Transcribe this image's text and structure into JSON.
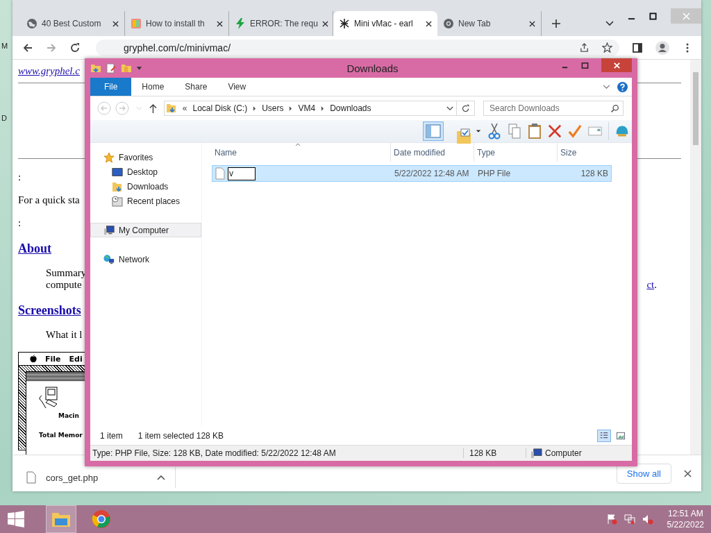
{
  "desktop": {
    "icon_labels": [
      "M",
      "D"
    ]
  },
  "browser": {
    "tabs": [
      {
        "title": "40 Best Custom",
        "selected": false
      },
      {
        "title": "How to install th",
        "selected": false
      },
      {
        "title": "ERROR: The requ",
        "selected": false
      },
      {
        "title": "Mini vMac - earl",
        "selected": true
      },
      {
        "title": "New Tab",
        "selected": false
      }
    ],
    "url": "gryphel.com/c/minivmac/",
    "page": {
      "site_link": "www.gryphel.c",
      "colon_1": ":",
      "quick_start": "For a quick sta",
      "colon_2": ":",
      "about": "About",
      "summary": "Summary",
      "computer": "compute",
      "link_end": "ct",
      "period": ".",
      "screenshots": "Screenshots",
      "what_it": "What it l",
      "mac_screenshot": {
        "menu": [
          "File",
          "Edi"
        ],
        "caption": "Macin",
        "memory": "Total Memor"
      }
    },
    "download": {
      "file": "cors_get.php",
      "show_all": "Show all"
    }
  },
  "explorer": {
    "title": "Downloads",
    "ribbon_tabs": [
      {
        "label": "File",
        "selected": true
      },
      {
        "label": "Home",
        "selected": false
      },
      {
        "label": "Share",
        "selected": false
      },
      {
        "label": "View",
        "selected": false
      }
    ],
    "crumb_overflow": "«",
    "crumbs": [
      "Local Disk (C:)",
      "Users",
      "VM4",
      "Downloads"
    ],
    "search": {
      "placeholder": "Search Downloads"
    },
    "nav": [
      {
        "label": "Favorites",
        "selected": false,
        "children": [
          {
            "label": "Desktop",
            "selected": false
          },
          {
            "label": "Downloads",
            "selected": false
          },
          {
            "label": "Recent places",
            "selected": false
          }
        ]
      },
      {
        "label": "My Computer",
        "selected": true
      },
      {
        "label": "Network",
        "selected": false
      }
    ],
    "columns": [
      "Name",
      "Date modified",
      "Type",
      "Size"
    ],
    "rows": [
      {
        "name_value": "v",
        "date": "5/22/2022 12:48 AM",
        "type": "PHP File",
        "size": "128 KB",
        "selected": true
      }
    ],
    "status": {
      "count": "1 item",
      "selection": "1 item selected  128 KB"
    },
    "details": {
      "info": "Type: PHP File, Size: 128 KB, Date modified: 5/22/2022 12:48 AM",
      "size": "128 KB",
      "location": "Computer"
    }
  },
  "taskbar": {
    "time": "12:51 AM",
    "date": "5/22/2022"
  }
}
